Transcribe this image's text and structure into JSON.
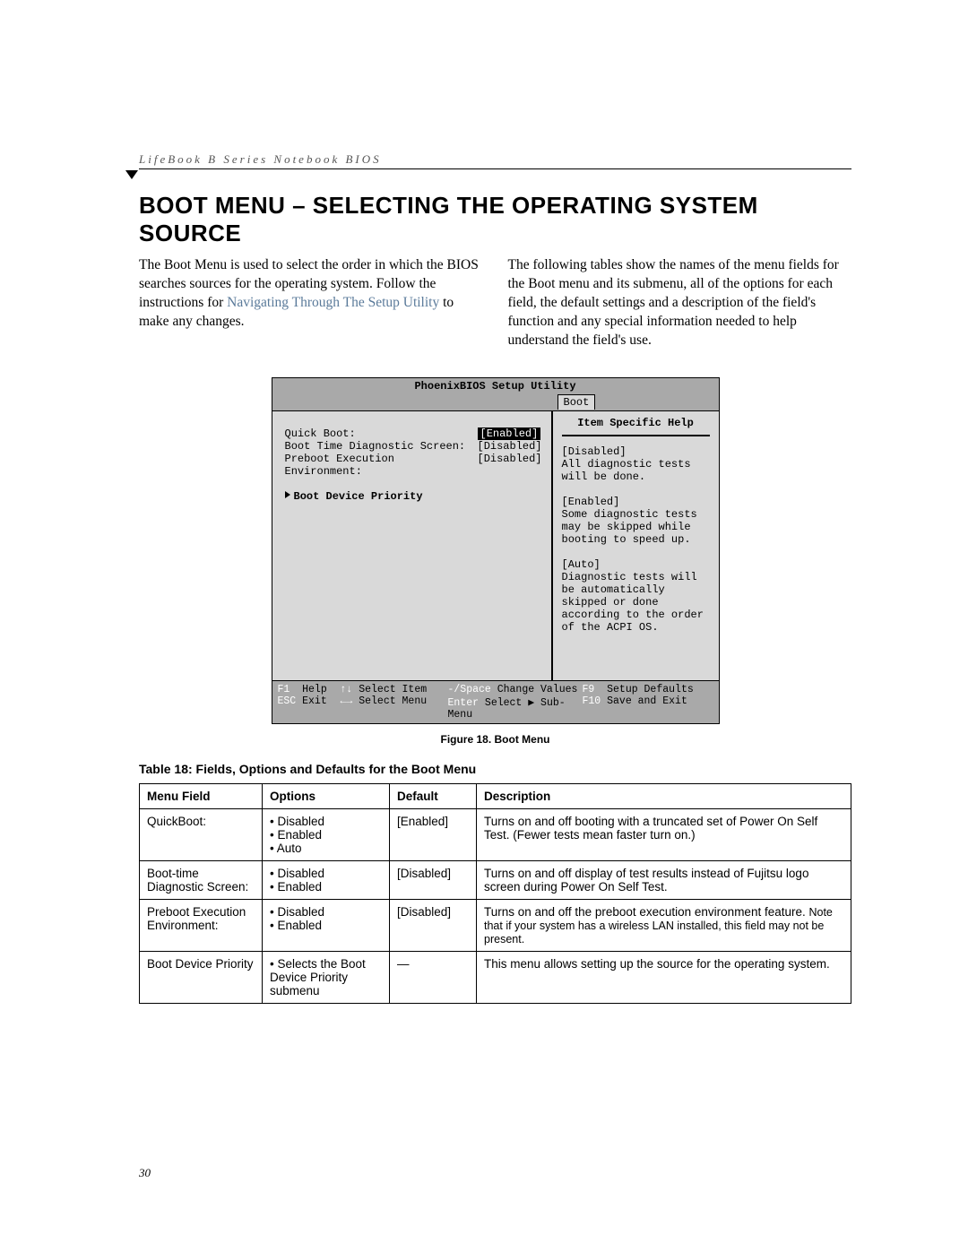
{
  "running_head": "LifeBook B Series Notebook BIOS",
  "section_title": "Boot Menu – Selecting the Operating System Source",
  "intro_left_1": "The Boot Menu is used to select the order in which the BIOS searches sources for the operating system. Follow the instructions for ",
  "intro_left_link": "Navigating Through The Setup Utility",
  "intro_left_2": " to make any changes.",
  "intro_right": "The following tables show the names of the menu fields for the Boot menu and its submenu, all of the options for each field, the default settings and a description of the field's function and any special information needed to help understand the field's use.",
  "bios": {
    "title": "PhoenixBIOS Setup Utility",
    "tab": "Boot",
    "rows": [
      {
        "label": "Quick Boot:",
        "value": "[Enabled]",
        "selected": true
      },
      {
        "label": "Boot Time Diagnostic Screen:",
        "value": "[Disabled]",
        "selected": false
      },
      {
        "label": "Preboot Execution Environment:",
        "value": "[Disabled]",
        "selected": false
      }
    ],
    "submenu": "Boot Device Priority",
    "help_title": "Item Specific Help",
    "help_body": "[Disabled]\nAll diagnostic tests will be done.\n\n[Enabled]\nSome diagnostic tests may be skipped while booting to speed up.\n\n[Auto]\nDiagnostic tests will be automatically skipped or done according to the order of the ACPI OS.",
    "footer": {
      "f1": "F1",
      "help": "Help",
      "arrows_v": "↑↓",
      "sel_item": "Select Item",
      "minus": "-/Space",
      "chg": "Change Values",
      "f9": "F9",
      "defaults": "Setup Defaults",
      "esc": "ESC",
      "exit": "Exit",
      "arrows_h": "←→",
      "sel_menu": "Select Menu",
      "enter": "Enter",
      "sub": "Select ▶ Sub-Menu",
      "f10": "F10",
      "save": "Save and Exit"
    }
  },
  "figure_caption": "Figure 18.  Boot Menu",
  "table_title": "Table 18: Fields, Options and Defaults for the Boot Menu",
  "table": {
    "headers": [
      "Menu Field",
      "Options",
      "Default",
      "Description"
    ],
    "rows": [
      {
        "field": "QuickBoot:",
        "options": [
          "Disabled",
          "Enabled",
          "Auto"
        ],
        "default": "[Enabled]",
        "desc": "Turns on and off booting with a truncated set of Power On Self Test. (Fewer tests mean faster turn on.)",
        "desc_note": ""
      },
      {
        "field": "Boot-time Diagnostic Screen:",
        "options": [
          "Disabled",
          "Enabled"
        ],
        "default": "[Disabled]",
        "desc": "Turns on and off display of test results instead of Fujitsu logo screen during Power On Self Test.",
        "desc_note": ""
      },
      {
        "field": "Preboot Execution Environment:",
        "options": [
          "Disabled",
          "Enabled"
        ],
        "default": "[Disabled]",
        "desc": "Turns on and off the preboot execution environment feature. ",
        "desc_note": "Note that if your system has a wireless LAN installed, this field may not be present."
      },
      {
        "field": "Boot Device Priority",
        "options": [
          "Selects the Boot Device Priority submenu"
        ],
        "default": "—",
        "desc": "This menu allows setting up the source for the operating system.",
        "desc_note": ""
      }
    ]
  },
  "page_number": "30"
}
